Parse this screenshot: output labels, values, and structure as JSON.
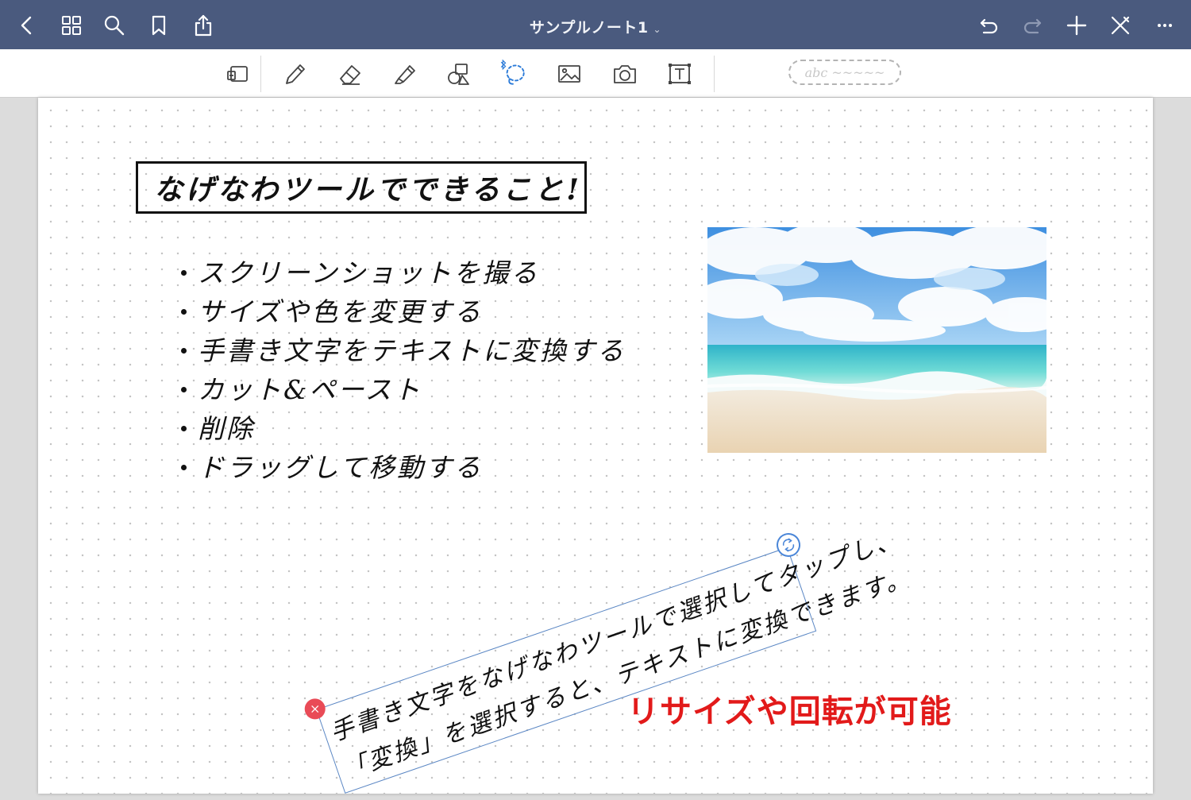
{
  "nav": {
    "title": "サンプルノート1",
    "title_chevron": "⌄",
    "bar_color": "#4a5a7e"
  },
  "toolbar": {
    "handwriting_chip": "abc ~~~~~",
    "selected_tool": "lasso"
  },
  "note": {
    "heading": "なげなわツールでできること!",
    "bullets": [
      "スクリーンショットを撮る",
      "サイズや色を変更する",
      "手書き文字をテキストに変換する",
      "カット&ペースト",
      "削除",
      "ドラッグして移動する"
    ],
    "selection_lines": [
      "手書き文字をなげなわツールで選択してタップし、",
      "「変換」を選択すると、テキストに変換できます。"
    ],
    "delete_symbol": "×",
    "annotation": "リサイズや回転が可能",
    "annotation_color": "#e21a1a",
    "selection_color": "#5b87c4"
  }
}
